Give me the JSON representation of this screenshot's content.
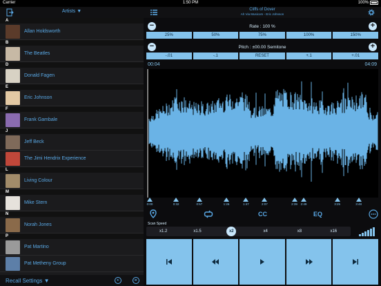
{
  "status": {
    "carrier": "Carrier",
    "time": "1:50 PM",
    "battery_percent": "100%"
  },
  "library": {
    "header_label": "Artists ▼",
    "sections": [
      {
        "letter": "A",
        "items": [
          {
            "name": "Allan Holdsworth",
            "thumb": "#5b3b2a"
          }
        ]
      },
      {
        "letter": "B",
        "items": [
          {
            "name": "The Beatles",
            "thumb": "#c7b9a5"
          }
        ]
      },
      {
        "letter": "D",
        "items": [
          {
            "name": "Donald Fagen",
            "thumb": "#d8d2c4"
          }
        ]
      },
      {
        "letter": "E",
        "items": [
          {
            "name": "Eric Johnson",
            "thumb": "#e3c9a4"
          }
        ]
      },
      {
        "letter": "F",
        "items": [
          {
            "name": "Frank Gambale",
            "thumb": "#8a6bb0"
          }
        ]
      },
      {
        "letter": "J",
        "items": [
          {
            "name": "Jeff Beck",
            "thumb": "#7f6a5a"
          },
          {
            "name": "The Jimi Hendrix Experience",
            "thumb": "#c0473a"
          }
        ]
      },
      {
        "letter": "L",
        "items": [
          {
            "name": "Living Colour",
            "thumb": "#a28c6a"
          }
        ]
      },
      {
        "letter": "M",
        "items": [
          {
            "name": "Mike Stern",
            "thumb": "#e6e2dc"
          }
        ]
      },
      {
        "letter": "N",
        "items": [
          {
            "name": "Norah Jones",
            "thumb": "#8a6a4a"
          }
        ]
      },
      {
        "letter": "P",
        "items": [
          {
            "name": "Pat Martino",
            "thumb": "#9a9a9a"
          },
          {
            "name": "Pat Metheny Group",
            "thumb": "#5d7fa8"
          }
        ]
      }
    ],
    "footer_label": "Recall Settings ▼"
  },
  "player": {
    "song_title": "Cliffs of Dover",
    "song_subtitle": "Ah Via Musicom - Eric Johnson",
    "rate_label": "Rate : 100 %",
    "rate_presets": [
      "25%",
      "50%",
      "75%",
      "100%",
      "150%"
    ],
    "pitch_label": "Pitch : ±00.00  Semitone",
    "pitch_presets": [
      "-.01",
      "-.1",
      "RESET",
      "+.1",
      "+.01"
    ],
    "time_current": "00:04",
    "time_total": "04:09",
    "duration_seconds": 249,
    "markers": [
      "0:00",
      "0:32",
      "0:57",
      "1:26",
      "1:47",
      "2:07",
      "2:39",
      "2:49",
      "3:25",
      "3:48"
    ],
    "tools": {
      "cc": "CC",
      "eq": "EQ"
    },
    "scan_speed_label": "Scan Speed",
    "scan_speeds": [
      "x1.2",
      "x1.5",
      "x2",
      "x4",
      "x8",
      "x16"
    ],
    "scan_selected": "x2"
  },
  "colors": {
    "accent": "#5aa9e6",
    "button": "#84c3ec",
    "wave": "#6ab3e6"
  }
}
